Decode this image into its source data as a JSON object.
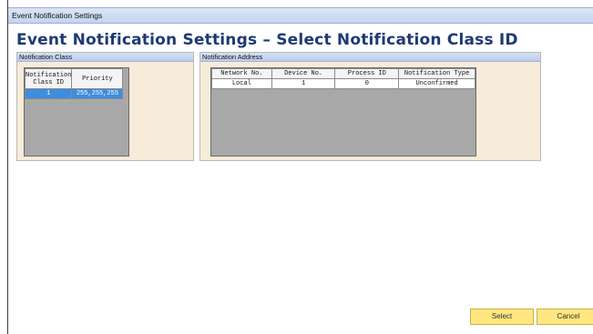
{
  "window": {
    "title": "Event Notification Settings"
  },
  "page": {
    "title": "Event Notification Settings – Select Notification Class ID"
  },
  "notification_class": {
    "panel_title": "Notification Class",
    "columns": [
      "Notification Class ID",
      "Priority"
    ],
    "rows": [
      {
        "class_id": "1",
        "priority": "255,255,255",
        "selected": true
      }
    ]
  },
  "notification_address": {
    "panel_title": "Notification Address",
    "columns": [
      "Network No.",
      "Device No.",
      "Process ID",
      "Notification Type"
    ],
    "rows": [
      {
        "network_no": "Local",
        "device_no": "1",
        "process_id": "0",
        "notification_type": "Unconfirmed"
      }
    ]
  },
  "buttons": {
    "select": "Select",
    "cancel": "Cancel"
  },
  "colors": {
    "title_text": "#1f3a73",
    "panel_bg": "#f7ecd9",
    "selected_row": "#3d8edc",
    "button_bg": "#ffe680"
  }
}
